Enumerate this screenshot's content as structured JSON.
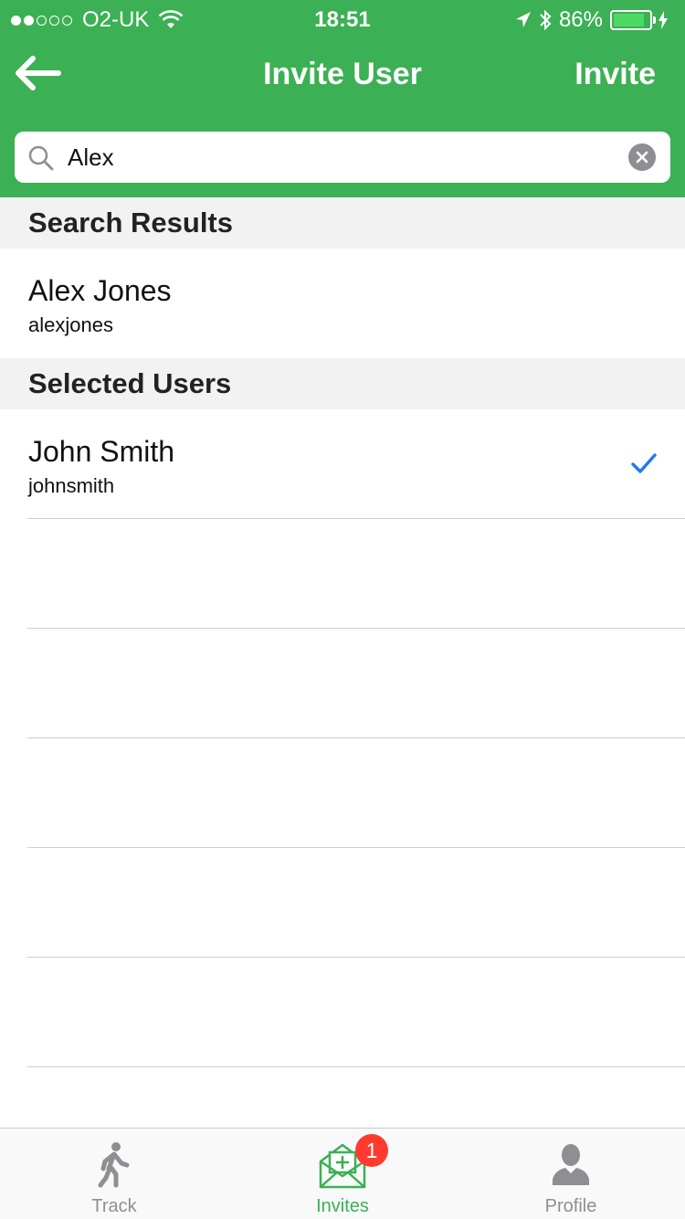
{
  "status_bar": {
    "carrier": "O2-UK",
    "time": "18:51",
    "battery_percent": "86%",
    "battery_level": 0.86,
    "signal_bars_filled": 2,
    "signal_bars_total": 5
  },
  "nav": {
    "title": "Invite User",
    "invite_label": "Invite"
  },
  "search": {
    "value": "Alex"
  },
  "sections": {
    "search_results_title": "Search Results",
    "selected_users_title": "Selected Users"
  },
  "search_results": [
    {
      "name": "Alex Jones",
      "username": "alexjones"
    }
  ],
  "selected_users": [
    {
      "name": "John Smith",
      "username": "johnsmith",
      "checked": true
    }
  ],
  "tabs": [
    {
      "label": "Track",
      "icon": "walking-person-icon"
    },
    {
      "label": "Invites",
      "icon": "envelope-add-icon",
      "badge": "1",
      "active": true
    },
    {
      "label": "Profile",
      "icon": "person-silhouette-icon"
    }
  ],
  "colors": {
    "primary": "#3cb054",
    "check": "#1a7cf5",
    "badge": "#ff3b30"
  }
}
